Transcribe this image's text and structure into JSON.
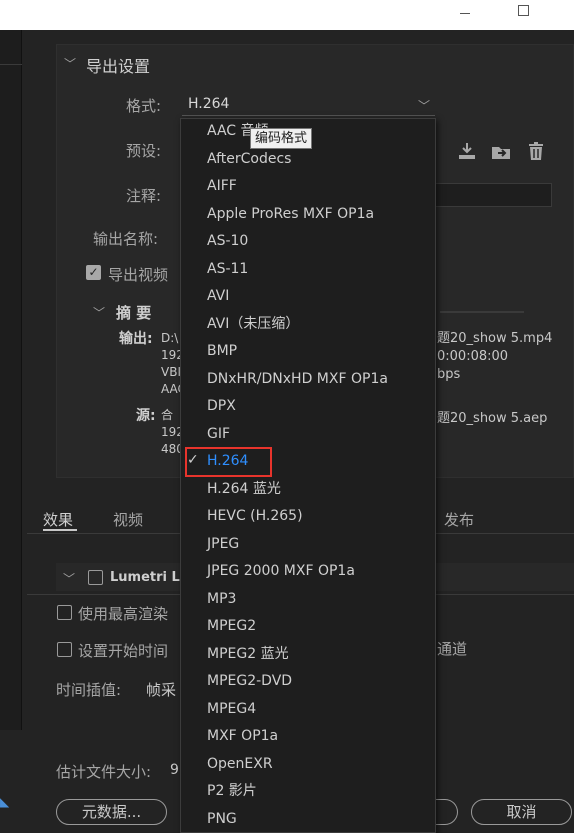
{
  "window": {
    "minimize_icon": "minimize-icon",
    "maximize_icon": "maximize-icon"
  },
  "export_settings": {
    "section_title": "导出设置",
    "format_label": "格式:",
    "format_value": "H.264",
    "preset_label": "预设:",
    "comment_label": "注释:",
    "output_name_label": "输出名称:",
    "export_video_label": "导出视频",
    "summary_title": "摘 要",
    "output_label": "输出:",
    "output_left_lines": [
      "D:\\",
      "192",
      "VBI",
      "AAC"
    ],
    "output_right_lines": [
      "题20_show 5.mp4",
      "0:00:08:00",
      "bps"
    ],
    "source_label": "源:",
    "source_left_lines": [
      "合",
      "192",
      "480"
    ],
    "source_right_lines": [
      "题20_show 5.aep"
    ]
  },
  "tabs": {
    "effects": "效果",
    "video": "视频",
    "publish": "发布"
  },
  "lumetri_label": "Lumetri Lo",
  "options": {
    "max_render_label": "使用最高渲染",
    "set_start_time_label": "设置开始时间",
    "channel_suffix": "通道",
    "time_interp_label": "时间插值:",
    "time_interp_value": "帧采",
    "est_size_label": "估计文件大小:",
    "est_size_value": "9"
  },
  "buttons": {
    "metadata": "元数据...",
    "cancel": "取消"
  },
  "tooltip": "编码格式",
  "dropdown_items": [
    "AAC 音频",
    "AfterCodecs",
    "AIFF",
    "Apple ProRes MXF OP1a",
    "AS-10",
    "AS-11",
    "AVI",
    "AVI（未压缩）",
    "BMP",
    "DNxHR/DNxHD MXF OP1a",
    "DPX",
    "GIF",
    "H.264",
    "H.264 蓝光",
    "HEVC (H.265)",
    "JPEG",
    "JPEG 2000 MXF OP1a",
    "MP3",
    "MPEG2",
    "MPEG2 蓝光",
    "MPEG2-DVD",
    "MPEG4",
    "MXF OP1a",
    "OpenEXR",
    "P2 影片",
    "PNG"
  ],
  "selected_item": "H.264",
  "colors": {
    "selected": "#2f8fff",
    "highlight": "#e8342c"
  }
}
